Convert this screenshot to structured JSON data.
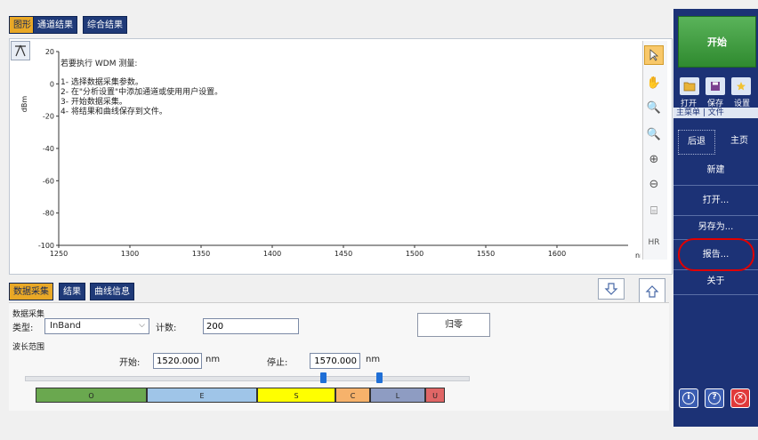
{
  "top_tabs": [
    "图形",
    "通道结果",
    "综合结果"
  ],
  "instructions": {
    "heading": "若要执行 WDM 测量:",
    "steps": [
      "1- 选择数据采集参数。",
      "2- 在\"分析设置\"中添加通道或使用用户设置。",
      "3- 开始数据采集。",
      "4- 将结果和曲线保存到文件。"
    ]
  },
  "chart_data": {
    "type": "line",
    "ylabel": "dBm",
    "xlabel": "nm",
    "x_ticks": [
      "1250",
      "1300",
      "1350",
      "1400",
      "1450",
      "1500",
      "1550",
      "1600"
    ],
    "y_ticks": [
      "20",
      "0",
      "-20",
      "-40",
      "-60",
      "-80",
      "-100"
    ],
    "xlim": [
      1250,
      1650
    ],
    "ylim": [
      -100,
      20
    ],
    "series": []
  },
  "side_tools": {
    "hr_label": "HR"
  },
  "bottom_tabs": [
    "数据采集",
    "结果",
    "曲线信息"
  ],
  "acquisition": {
    "group_label": "数据采集",
    "type_label": "类型:",
    "type_value": "InBand",
    "count_label": "计数:",
    "count_value": "200",
    "zero_button": "归零"
  },
  "wavelength": {
    "group_label": "波长范围",
    "start_label": "开始:",
    "start_value": "1520.000",
    "stop_label": "停止:",
    "stop_value": "1570.000",
    "unit": "nm",
    "bands": [
      {
        "label": "O",
        "color": "#6aa84f"
      },
      {
        "label": "E",
        "color": "#9fc5e8"
      },
      {
        "label": "S",
        "color": "#ffff00"
      },
      {
        "label": "C",
        "color": "#f6b26b"
      },
      {
        "label": "L",
        "color": "#8e9cc2"
      },
      {
        "label": "U",
        "color": "#e06666"
      }
    ]
  },
  "right_panel": {
    "start_button": "开始",
    "quick": [
      "打开",
      "保存",
      "设置"
    ],
    "crumb": "主菜单 | 文件",
    "back": "后退",
    "home": "主页",
    "menu": [
      "新建",
      "打开...",
      "另存为...",
      "报告...",
      "关于"
    ]
  }
}
